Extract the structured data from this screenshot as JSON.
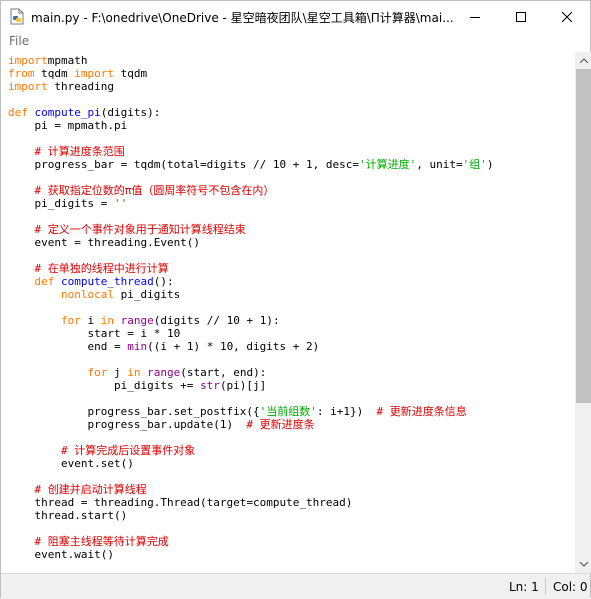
{
  "window": {
    "title": "main.py - F:\\onedrive\\OneDrive - 星空暗夜团队\\星空工具箱\\Π计算器\\mai...",
    "app_icon": "python-file-icon",
    "controls": {
      "minimize": "minimize-icon",
      "maximize": "maximize-icon",
      "close": "close-icon"
    }
  },
  "menu": {
    "file_label": "File"
  },
  "code_lines": [
    [
      [
        "kw",
        "import"
      ],
      [
        "",
        "mpmath"
      ]
    ],
    [
      [
        "kw",
        "from"
      ],
      [
        "",
        " tqdm "
      ],
      [
        "kw",
        "import"
      ],
      [
        "",
        " tqdm"
      ]
    ],
    [
      [
        "kw",
        "import"
      ],
      [
        "",
        " threading"
      ]
    ],
    [],
    [
      [
        "kw",
        "def"
      ],
      [
        "",
        " "
      ],
      [
        "fn",
        "compute_pi"
      ],
      [
        "",
        "(digits):"
      ]
    ],
    [
      [
        "",
        "    pi = mpmath.pi"
      ]
    ],
    [],
    [
      [
        "",
        "    "
      ],
      [
        "cm",
        "# 计算进度条范围"
      ]
    ],
    [
      [
        "",
        "    progress_bar = tqdm(total=digits // 10 + 1, desc="
      ],
      [
        "st",
        "'计算进度'"
      ],
      [
        "",
        ", unit="
      ],
      [
        "st",
        "'组'"
      ],
      [
        "",
        ")"
      ]
    ],
    [],
    [
      [
        "",
        "    "
      ],
      [
        "cm",
        "# 获取指定位数的π值（圆周率符号不包含在内）"
      ]
    ],
    [
      [
        "",
        "    pi_digits = "
      ],
      [
        "st",
        "''"
      ]
    ],
    [],
    [
      [
        "",
        "    "
      ],
      [
        "cm",
        "# 定义一个事件对象用于通知计算线程结束"
      ]
    ],
    [
      [
        "",
        "    event = threading.Event()"
      ]
    ],
    [],
    [
      [
        "",
        "    "
      ],
      [
        "cm",
        "# 在单独的线程中进行计算"
      ]
    ],
    [
      [
        "",
        "    "
      ],
      [
        "kw",
        "def"
      ],
      [
        "",
        " "
      ],
      [
        "fn",
        "compute_thread"
      ],
      [
        "",
        "():"
      ]
    ],
    [
      [
        "",
        "        "
      ],
      [
        "kw",
        "nonlocal"
      ],
      [
        "",
        " pi_digits"
      ]
    ],
    [],
    [
      [
        "",
        "        "
      ],
      [
        "kw",
        "for"
      ],
      [
        "",
        " i "
      ],
      [
        "kw",
        "in"
      ],
      [
        "",
        " "
      ],
      [
        "bi",
        "range"
      ],
      [
        "",
        "(digits // 10 + 1):"
      ]
    ],
    [
      [
        "",
        "            start = i * 10"
      ]
    ],
    [
      [
        "",
        "            end = "
      ],
      [
        "bi",
        "min"
      ],
      [
        "",
        "((i + 1) * 10, digits + 2)"
      ]
    ],
    [],
    [
      [
        "",
        "            "
      ],
      [
        "kw",
        "for"
      ],
      [
        "",
        " j "
      ],
      [
        "kw",
        "in"
      ],
      [
        "",
        " "
      ],
      [
        "bi",
        "range"
      ],
      [
        "",
        "(start, end):"
      ]
    ],
    [
      [
        "",
        "                pi_digits += "
      ],
      [
        "bi",
        "str"
      ],
      [
        "",
        "(pi)[j]"
      ]
    ],
    [],
    [
      [
        "",
        "            progress_bar.set_postfix({"
      ],
      [
        "st",
        "'当前组数'"
      ],
      [
        "",
        ": i+1})  "
      ],
      [
        "cm",
        "# 更新进度条信息"
      ]
    ],
    [
      [
        "",
        "            progress_bar.update(1)  "
      ],
      [
        "cm",
        "# 更新进度条"
      ]
    ],
    [],
    [
      [
        "",
        "        "
      ],
      [
        "cm",
        "# 计算完成后设置事件对象"
      ]
    ],
    [
      [
        "",
        "        event.set()"
      ]
    ],
    [],
    [
      [
        "",
        "    "
      ],
      [
        "cm",
        "# 创建并启动计算线程"
      ]
    ],
    [
      [
        "",
        "    thread = threading.Thread(target=compute_thread)"
      ]
    ],
    [
      [
        "",
        "    thread.start()"
      ]
    ],
    [],
    [
      [
        "",
        "    "
      ],
      [
        "cm",
        "# 阻塞主线程等待计算完成"
      ]
    ],
    [
      [
        "",
        "    event.wait()"
      ]
    ]
  ],
  "syntax_colors": {
    "keyword": "#ff7700",
    "builtin": "#900090",
    "function_name": "#0000ff",
    "comment": "#dd0000",
    "string": "#00aa00"
  },
  "status": {
    "line": "Ln: 1",
    "column": "Col: 0"
  }
}
